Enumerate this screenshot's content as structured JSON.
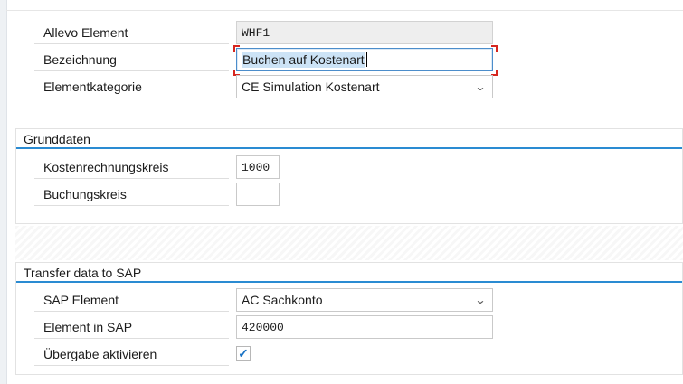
{
  "header": {
    "allevo_element": {
      "label": "Allevo Element",
      "value": "WHF1"
    },
    "bezeichnung": {
      "label": "Bezeichnung",
      "value": "Buchen auf Kostenart"
    },
    "elementkategorie": {
      "label": "Elementkategorie",
      "value": "CE Simulation Kostenart"
    }
  },
  "grunddaten": {
    "title": "Grunddaten",
    "kostenrechnungskreis": {
      "label": "Kostenrechnungskreis",
      "value": "1000"
    },
    "buchungskreis": {
      "label": "Buchungskreis",
      "value": ""
    }
  },
  "transfer": {
    "title": "Transfer data to SAP",
    "sap_element": {
      "label": "SAP Element",
      "value": "AC Sachkonto"
    },
    "element_in_sap": {
      "label": "Element in SAP",
      "value": "420000"
    },
    "uebergabe": {
      "label": "Übergabe aktivieren",
      "checked": true
    }
  },
  "icons": {
    "dropdown": "chevron-down-icon",
    "checkbox": "checkmark-icon"
  },
  "colors": {
    "accent": "#2a8bd2",
    "focus_corner": "#d6261f",
    "selection": "#cce3f6"
  }
}
